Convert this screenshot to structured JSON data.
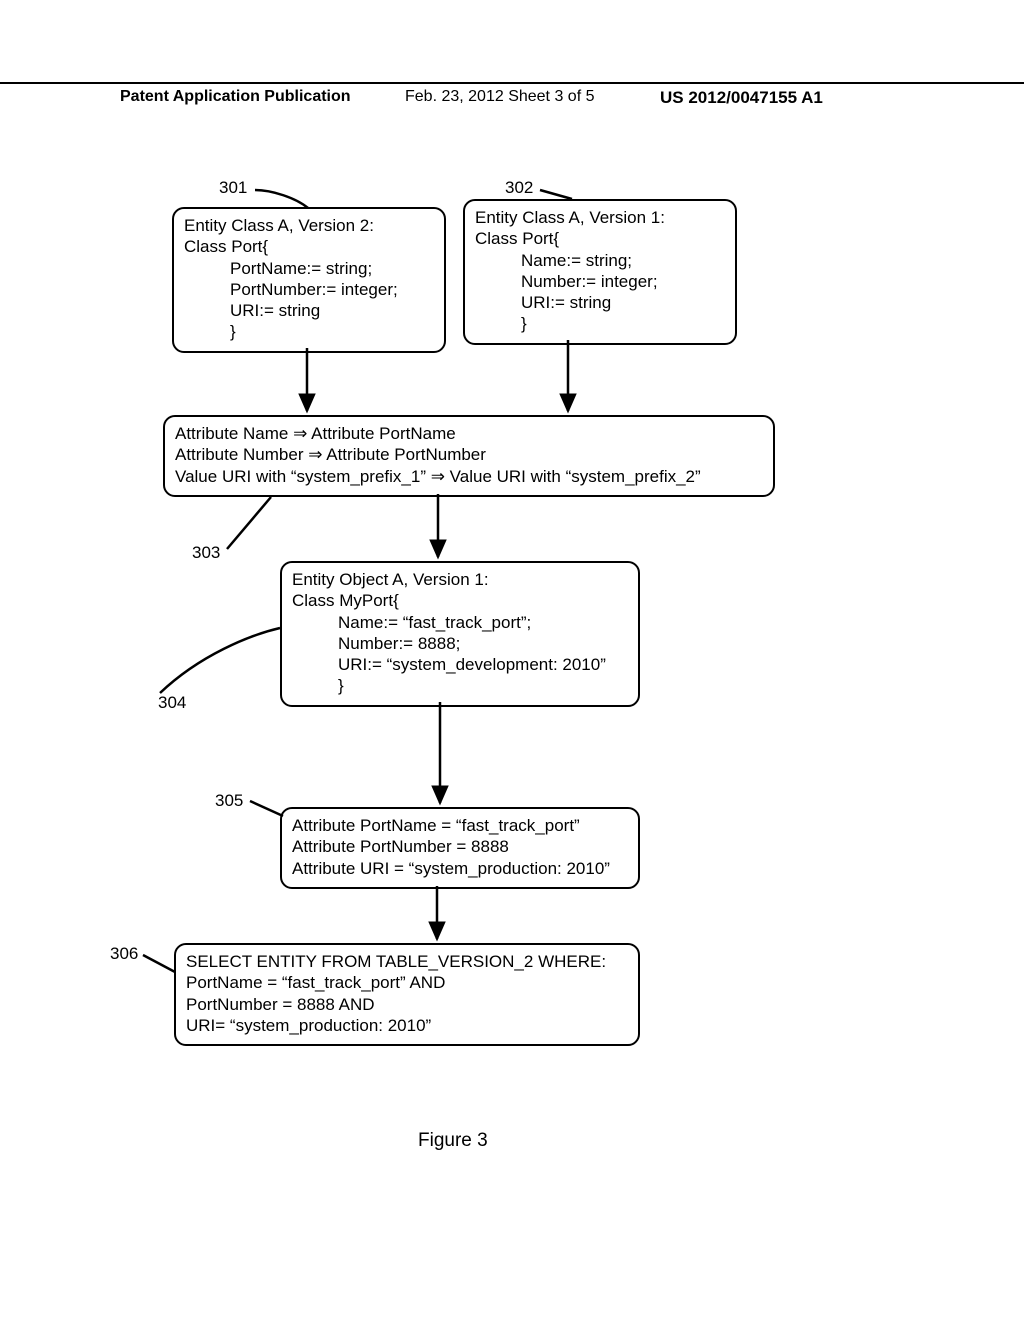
{
  "header": {
    "left": "Patent Application Publication",
    "mid": "Feb. 23, 2012  Sheet 3 of 5",
    "right": "US 2012/0047155 A1"
  },
  "labels": {
    "l301": "301",
    "l302": "302",
    "l303": "303",
    "l304": "304",
    "l305": "305",
    "l306": "306"
  },
  "box301": {
    "l1": "Entity Class A, Version 2:",
    "l2": "Class Port{",
    "l3": "PortName:= string;",
    "l4": "PortNumber:= integer;",
    "l5": "URI:= string",
    "l6": "}"
  },
  "box302": {
    "l1": "Entity Class A, Version 1:",
    "l2": "Class Port{",
    "l3": "Name:= string;",
    "l4": "Number:= integer;",
    "l5": "URI:= string",
    "l6": "}"
  },
  "box303": {
    "l1": "Attribute Name ⇒ Attribute PortName",
    "l2": "Attribute Number ⇒ Attribute PortNumber",
    "l3": "Value URI with “system_prefix_1” ⇒ Value URI with “system_prefix_2”"
  },
  "box304": {
    "l1": "Entity Object A, Version 1:",
    "l2": "Class MyPort{",
    "l3": "Name:= “fast_track_port”;",
    "l4": "Number:= 8888;",
    "l5": "URI:= “system_development: 2010”",
    "l6": "}"
  },
  "box305": {
    "l1": "Attribute PortName = “fast_track_port”",
    "l2": "Attribute PortNumber = 8888",
    "l3": "Attribute URI = “system_production: 2010”"
  },
  "box306": {
    "l1": "SELECT ENTITY FROM TABLE_VERSION_2 WHERE:",
    "l2": "PortName = “fast_track_port” AND",
    "l3": "PortNumber = 8888 AND",
    "l4": "URI= “system_production: 2010”"
  },
  "figure_caption": "Figure 3"
}
